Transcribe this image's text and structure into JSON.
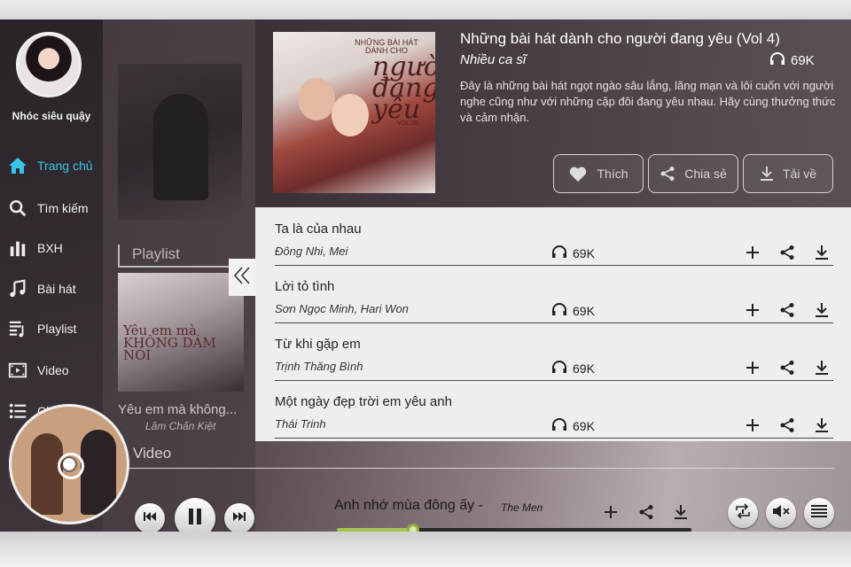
{
  "sidebar": {
    "username": "Nhóc siêu quậy",
    "items": [
      {
        "label": "Trang chủ",
        "icon": "home-icon",
        "active": true
      },
      {
        "label": "Tìm kiếm",
        "icon": "search-icon"
      },
      {
        "label": "BXH",
        "icon": "chart-icon"
      },
      {
        "label": "Bài hát",
        "icon": "music-note-icon"
      },
      {
        "label": "Playlist",
        "icon": "playlist-icon"
      },
      {
        "label": "Video",
        "icon": "video-icon"
      },
      {
        "label": "Ch...",
        "icon": "list-icon"
      }
    ]
  },
  "background": {
    "playlist_heading": "Playlist",
    "song_title": "Yêu em mà không...",
    "song_artist": "Lâm Chấn Kiệt",
    "cover_text": "Yêu em mà KHÔNG DÁM NÓI",
    "video_heading": "Video"
  },
  "album": {
    "title": "Những bài hát dành cho người đang yêu (Vol 4)",
    "artist": "Nhiều ca sĩ",
    "listens": "69K",
    "description": "Đây là những bài hát ngọt ngào sâu lắng, lãng mạn và lôi cuốn với người nghe cũng như với những cặp đôi đang yêu nhau. Hãy cùng thưởng thức và cảm nhận.",
    "cover": {
      "line1": "NHỮNG BÀI HÁT DÀNH CHO",
      "line2": "người đang yêu",
      "line3": "VOL.05"
    },
    "like_label": "Thích",
    "share_label": "Chia sẻ",
    "download_label": "Tải về"
  },
  "songs": [
    {
      "name": "Ta là của nhau",
      "artist": "Đông Nhi, Mei",
      "listens": "69K"
    },
    {
      "name": "Lời tỏ tình",
      "artist": "Sơn Ngọc Minh, Hari Won",
      "listens": "69K"
    },
    {
      "name": "Từ khi gặp em",
      "artist": "Trịnh Thăng Bình",
      "listens": "69K"
    },
    {
      "name": "Một ngày đẹp trời em yêu anh",
      "artist": "Thái Trinh",
      "listens": "69K"
    }
  ],
  "player": {
    "title": "Anh nhớ mùa đông ấy -",
    "artist": "The Men",
    "progress": 0.215
  },
  "colors": {
    "accent": "#38c4e8",
    "progress": "#a6c552"
  }
}
